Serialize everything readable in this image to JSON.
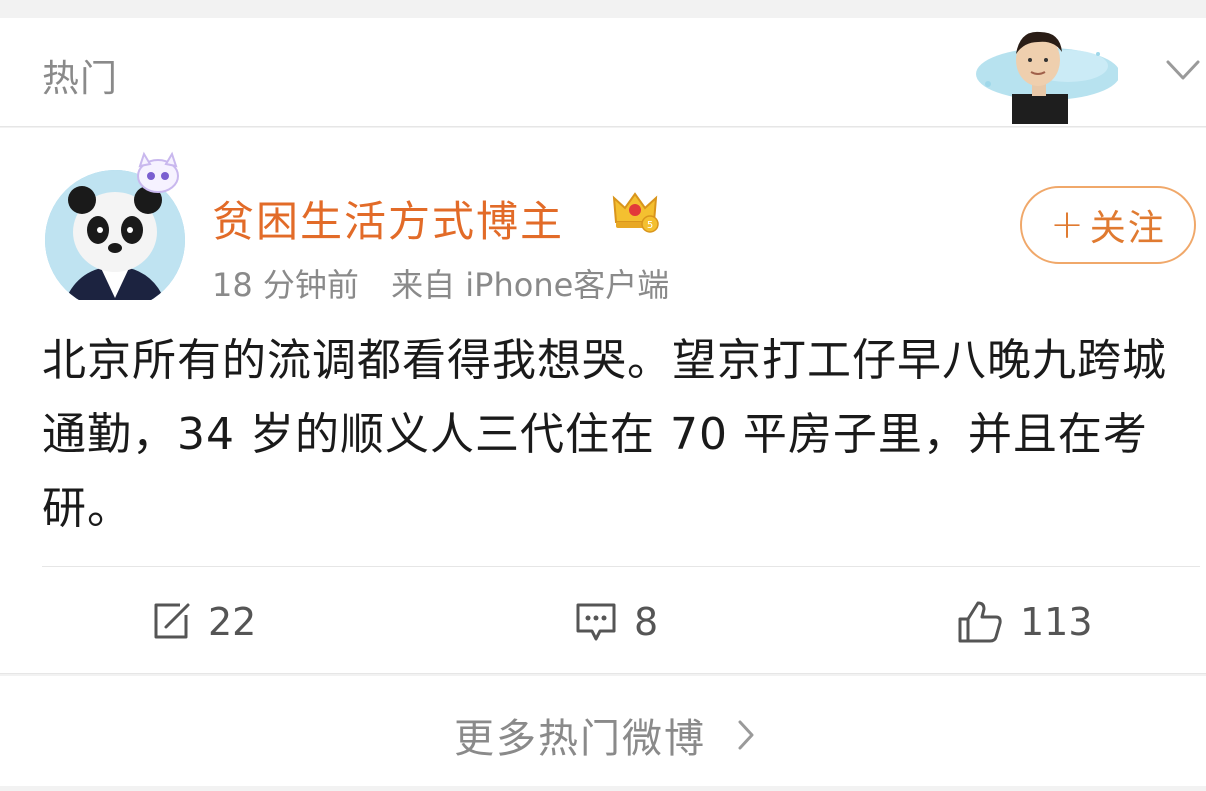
{
  "header": {
    "section_title": "热门",
    "banner_icon": "celebrity-portrait-banner",
    "expand_icon": "chevron-down-icon"
  },
  "post": {
    "username": "贫困生活方式博主",
    "username_color": "#e26b28",
    "vip_badge_icon": "crown-vip-badge-icon",
    "time": "18 分钟前",
    "source_prefix": "来自",
    "source_app": "iPhone",
    "source_suffix": "客户端",
    "follow_label": "关注",
    "follow_plus": "+",
    "text": "北京所有的流调都看得我想哭。望京打工仔早八晚九跨城通勤，34 岁的顺义人三代住在 70 平房子里，并且在考研。",
    "actions": {
      "repost_count": "22",
      "comment_count": "8",
      "like_count": "113"
    }
  },
  "footer": {
    "more_label": "更多热门微博"
  }
}
